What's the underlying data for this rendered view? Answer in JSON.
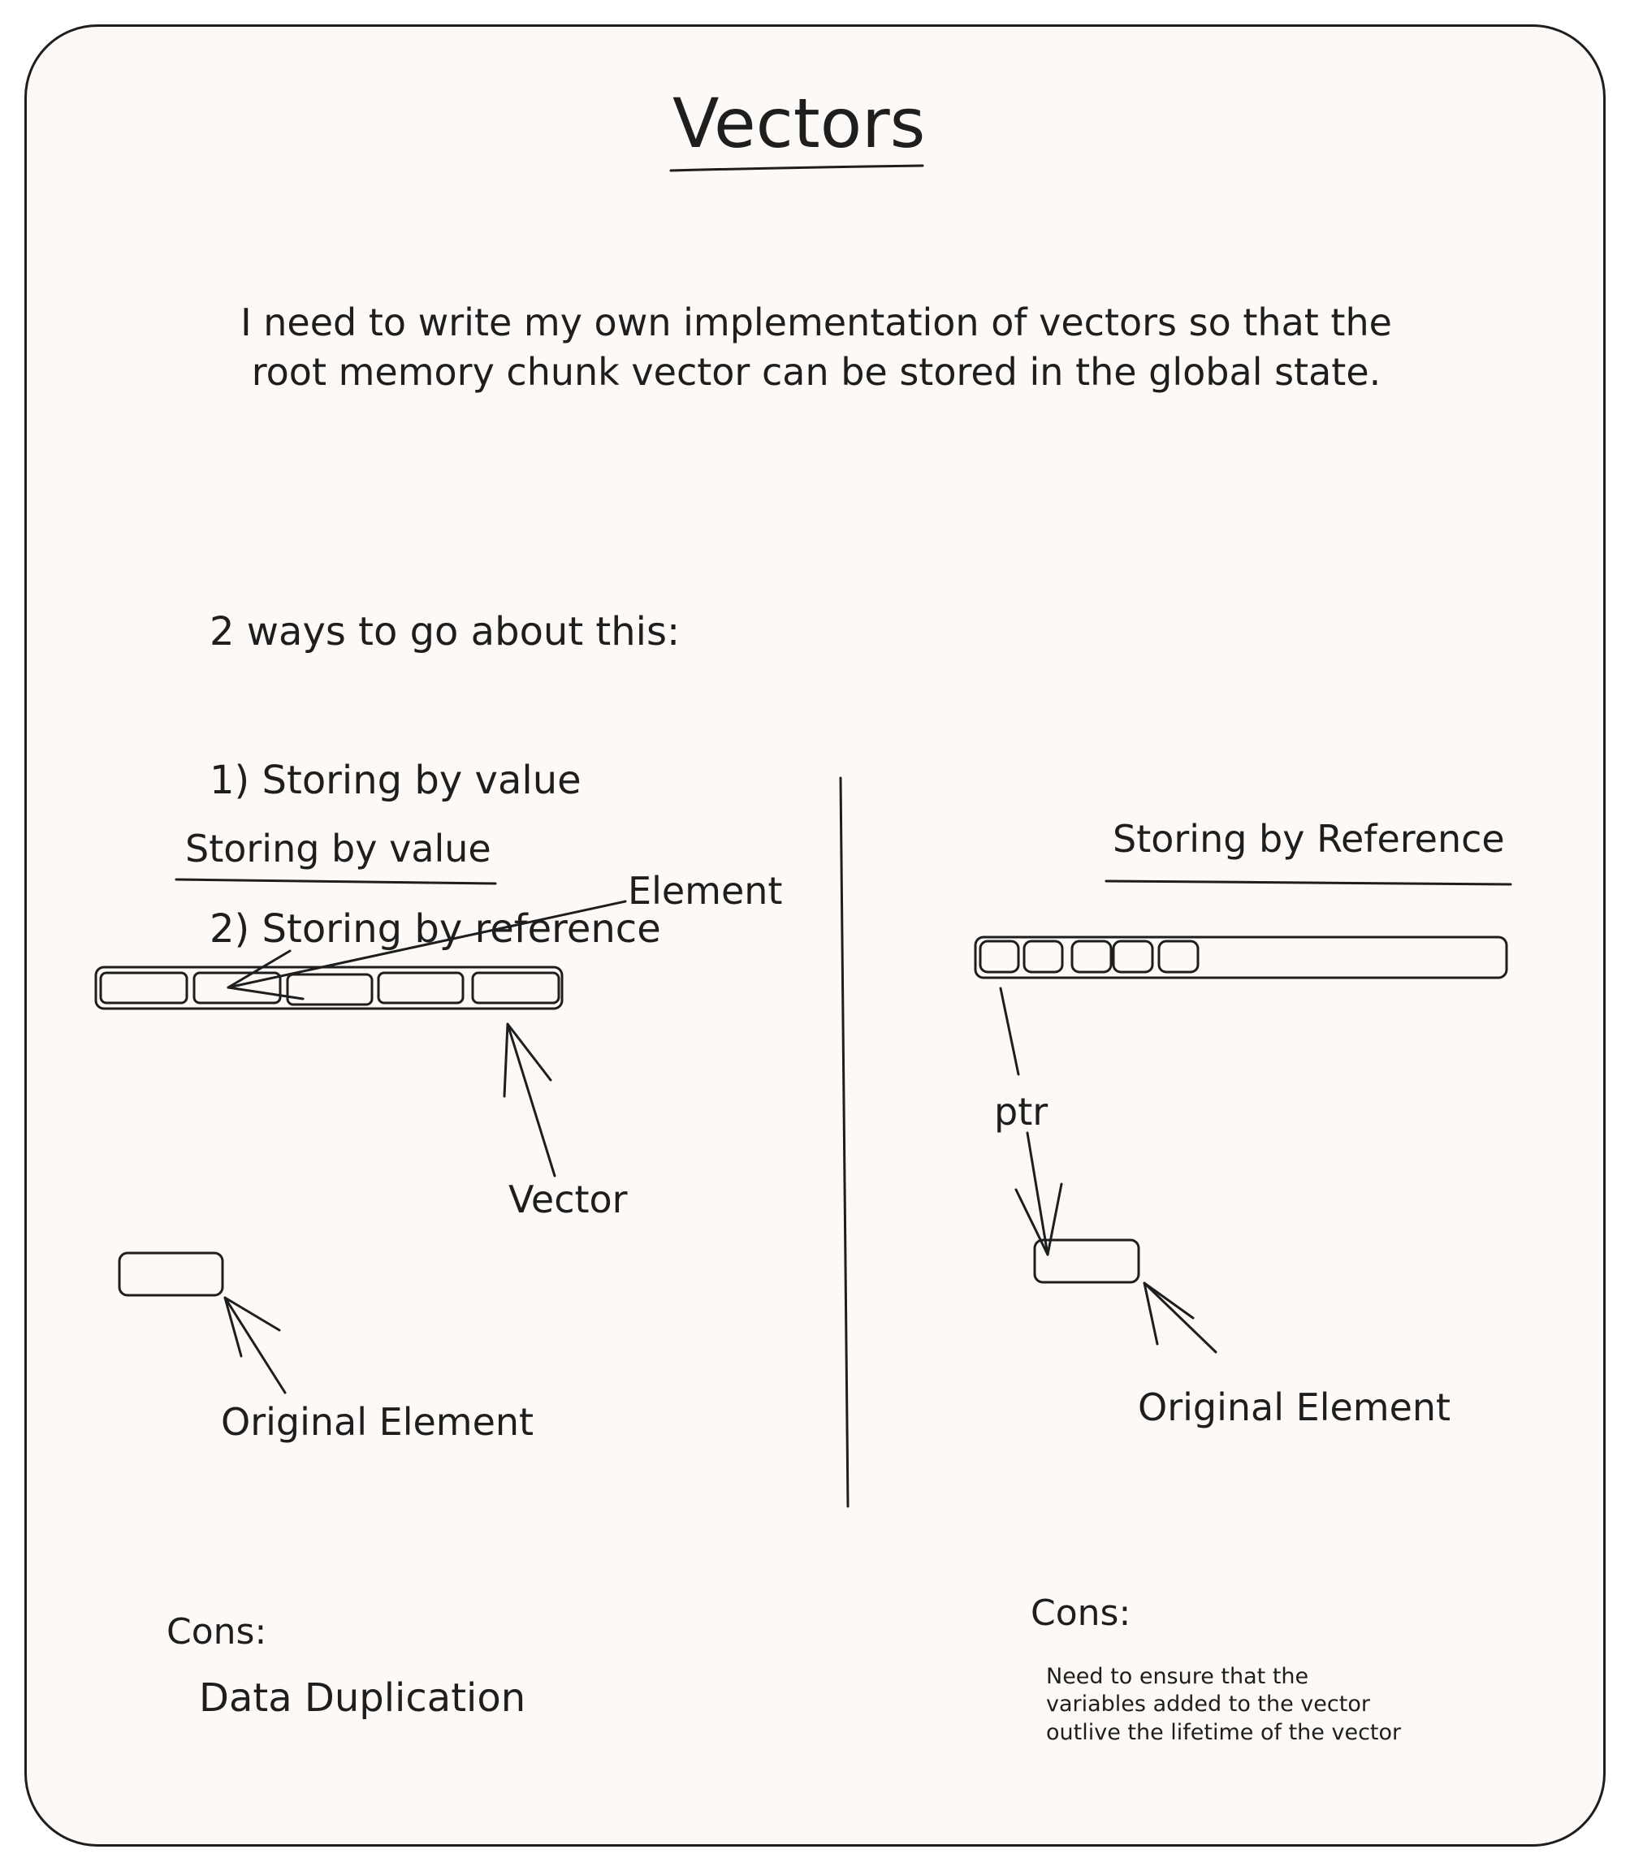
{
  "title": "Vectors",
  "intro": "I need to write my own implementation of vectors so that the\nroot memory chunk vector can be stored in the global state.",
  "ways": {
    "heading": "2 ways to go about this:",
    "items": [
      "1) Storing by value",
      "2) Storing by reference"
    ]
  },
  "by_value": {
    "heading": "Storing by value",
    "element_label": "Element",
    "vector_label": "Vector",
    "original_label": "Original Element",
    "cons_label": "Cons:",
    "cons_text": "Data Duplication"
  },
  "by_reference": {
    "heading": "Storing by Reference",
    "pointer_label": "ptr",
    "original_label": "Original Element",
    "cons_label": "Cons:",
    "cons_text": "Need to ensure that the\nvariables added to the vector\noutlive the lifetime of the vector"
  },
  "colors": {
    "ink": "#1e1e1e",
    "paper": "#fcf9f6",
    "background": "#ffffff"
  }
}
